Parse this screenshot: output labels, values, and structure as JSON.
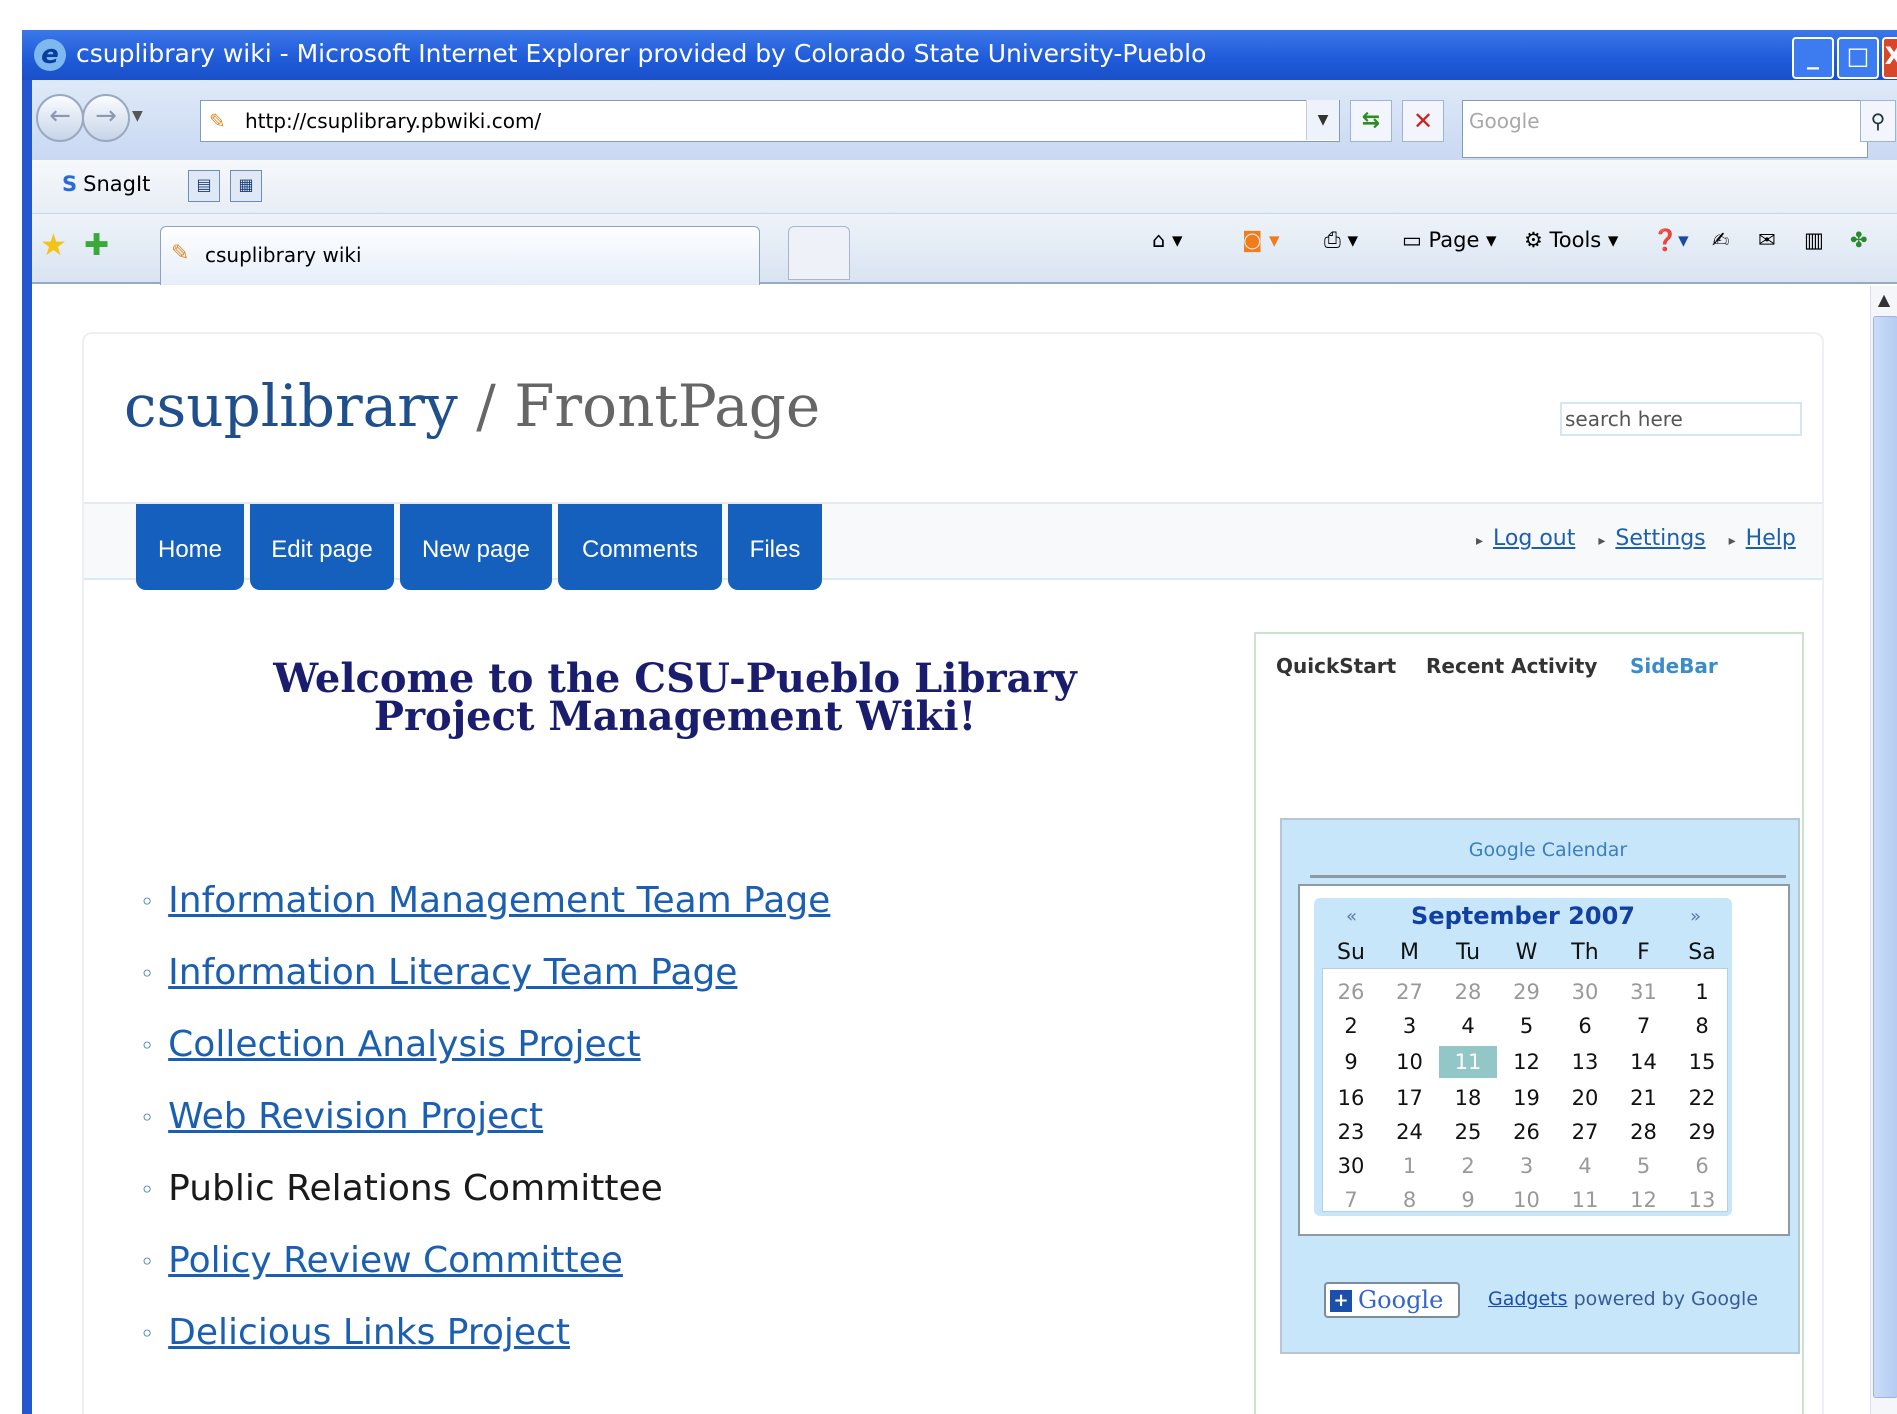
{
  "window": {
    "title": "csuplibrary wiki - Microsoft Internet Explorer provided by Colorado State University-Pueblo",
    "min": "_",
    "max": "□",
    "close": "X"
  },
  "addressbar": {
    "url": "http://csuplibrary.pbwiki.com/",
    "search_placeholder": "Google"
  },
  "linksbar": {
    "snagit": "SnagIt"
  },
  "tabs": {
    "active_tab": "csuplibrary wiki"
  },
  "commandbar": {
    "page": "Page",
    "tools": "Tools"
  },
  "wiki": {
    "site": "csuplibrary",
    "separator": "/",
    "page": "FrontPage",
    "search_placeholder": "search here",
    "nav": [
      "Home",
      "Edit page",
      "New page",
      "Comments",
      "Files"
    ],
    "toplinks": [
      "Log out",
      "Settings",
      "Help"
    ],
    "welcome_line1": "Welcome to the CSU-Pueblo Library",
    "welcome_line2": "Project Management Wiki!",
    "links": [
      {
        "text": "Information Management Team Page",
        "link": true
      },
      {
        "text": "Information Literacy Team Page",
        "link": true
      },
      {
        "text": "Collection Analysis Project",
        "link": true
      },
      {
        "text": "Web Revision Project",
        "link": true
      },
      {
        "text": "Public Relations Committee",
        "link": false
      },
      {
        "text": "Policy Review Committee",
        "link": true
      },
      {
        "text": "Delicious Links Project",
        "link": true
      }
    ]
  },
  "sidebar": {
    "tabs": [
      "QuickStart",
      "Recent Activity",
      "SideBar"
    ],
    "active_tab": "SideBar"
  },
  "calendar": {
    "gadget_title": "Google Calendar",
    "month": "September 2007",
    "prev": "«",
    "next": "»",
    "dow": [
      "Su",
      "M",
      "Tu",
      "W",
      "Th",
      "F",
      "Sa"
    ],
    "weeks": [
      [
        "26",
        "27",
        "28",
        "29",
        "30",
        "31",
        "1"
      ],
      [
        "2",
        "3",
        "4",
        "5",
        "6",
        "7",
        "8"
      ],
      [
        "9",
        "10",
        "11",
        "12",
        "13",
        "14",
        "15"
      ],
      [
        "16",
        "17",
        "18",
        "19",
        "20",
        "21",
        "22"
      ],
      [
        "23",
        "24",
        "25",
        "26",
        "27",
        "28",
        "29"
      ],
      [
        "30",
        "1",
        "2",
        "3",
        "4",
        "5",
        "6"
      ],
      [
        "7",
        "8",
        "9",
        "10",
        "11",
        "12",
        "13"
      ]
    ],
    "today": "11",
    "google_button": "Google",
    "footer_link": "Gadgets",
    "footer_text": " powered by Google"
  },
  "colors": {
    "title_bar": "#1f5ad9",
    "nav_tab": "#1560bd",
    "link": "#1b5fb0",
    "welcome": "#1a1d6e",
    "gadget_bg": "#c7e6f9"
  }
}
